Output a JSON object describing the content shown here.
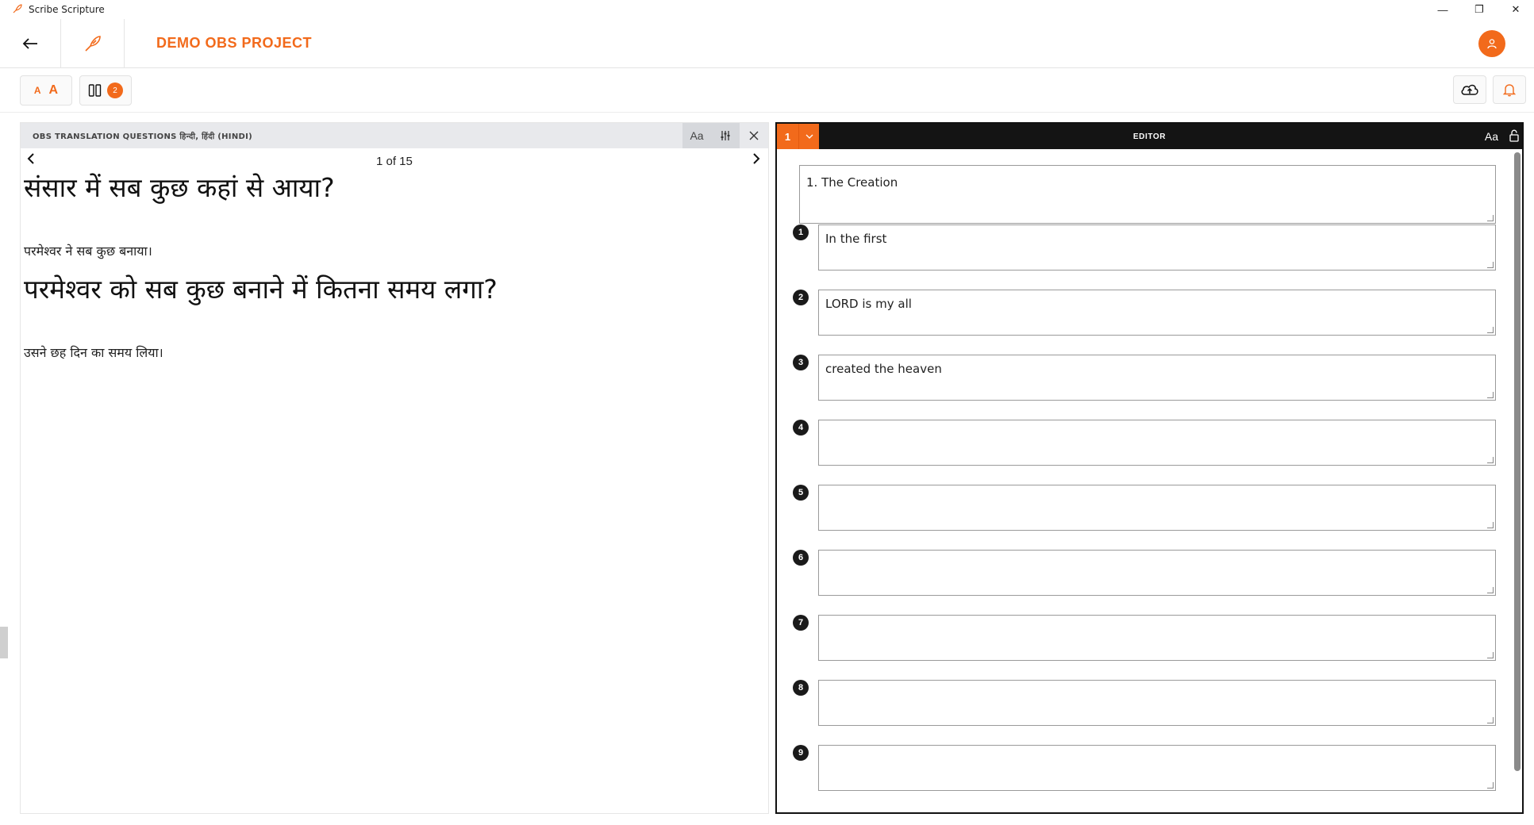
{
  "window": {
    "title": "Scribe Scripture",
    "controls": [
      "—",
      "❐",
      "✕"
    ]
  },
  "header": {
    "project_title": "DEMO OBS PROJECT",
    "back_icon": "arrow-left-icon",
    "logo_icon": "quill-icon",
    "user_icon": "user-icon"
  },
  "toolbar": {
    "font_small": "A",
    "font_large": "A",
    "layout_badge": "2"
  },
  "resource_pane": {
    "title": "OBS TRANSLATION QUESTIONS हिन्दी, हिंदी (HINDI)",
    "page_count": "1 of 15",
    "items": [
      {
        "question": "संसार में सब कुछ कहां से आया?",
        "answer": "परमेश्वर ने सब कुछ बनाया।"
      },
      {
        "question": "परमेश्वर को सब कुछ बनाने में कितना समय लगा?",
        "answer": "उसने छह दिन का समय लिया।"
      }
    ]
  },
  "editor": {
    "chapter": "1",
    "title": "EDITOR",
    "font_tool": "Aa",
    "story_title": "1. The Creation",
    "frames": [
      {
        "num": "1",
        "text": "In the first"
      },
      {
        "num": "2",
        "text": "LORD is my all"
      },
      {
        "num": "3",
        "text": "created the heaven"
      },
      {
        "num": "4",
        "text": ""
      },
      {
        "num": "5",
        "text": ""
      },
      {
        "num": "6",
        "text": ""
      },
      {
        "num": "7",
        "text": ""
      },
      {
        "num": "8",
        "text": ""
      },
      {
        "num": "9",
        "text": ""
      }
    ]
  },
  "colors": {
    "accent": "#f26a1b",
    "editor_header": "#141414",
    "pane_header": "#e8e9ec"
  }
}
